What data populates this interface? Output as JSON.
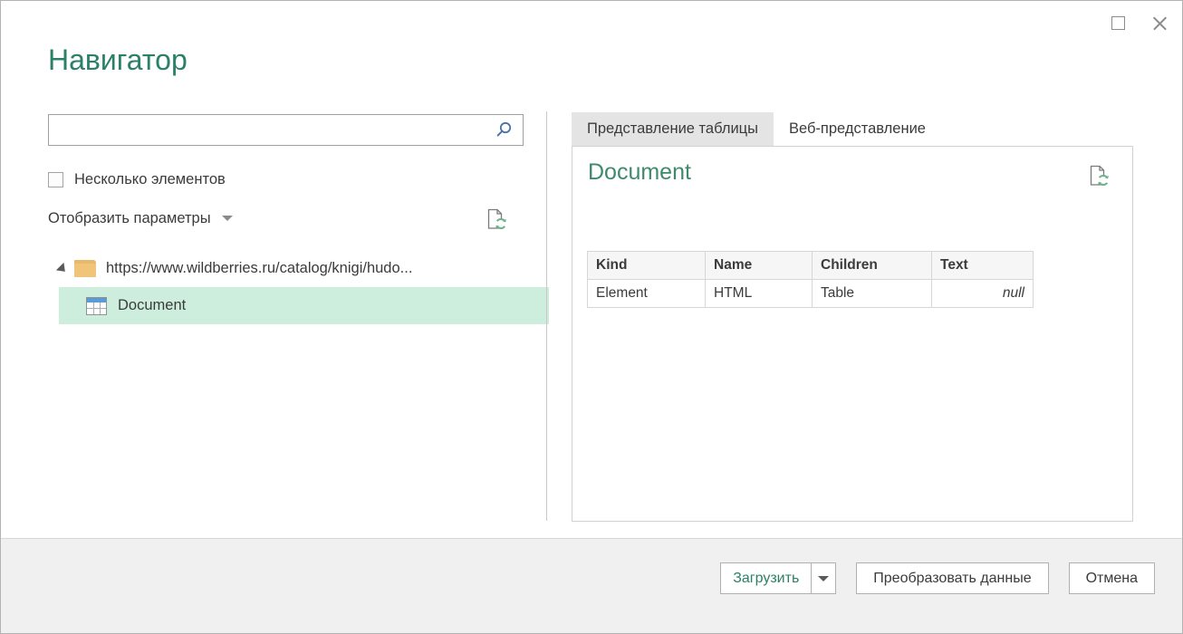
{
  "window": {
    "maximize_icon": "maximize-square-icon",
    "close_icon": "close-x-icon"
  },
  "title": "Навигатор",
  "left_pane": {
    "search": {
      "value": "",
      "placeholder": "",
      "icon": "search-magnifier-icon"
    },
    "multiple_items_checkbox": {
      "label": "Несколько элементов",
      "checked": false
    },
    "display_options": {
      "label": "Отобразить параметры",
      "caret_icon": "chevron-down-icon"
    },
    "refresh_icon": "page-refresh-icon",
    "tree": {
      "root": {
        "label": "https://www.wildberries.ru/catalog/knigi/hudo...",
        "icon": "folder-icon",
        "expander_icon": "expander-expanded-icon",
        "expanded": true
      },
      "children": [
        {
          "label": "Document",
          "icon": "table-icon",
          "selected": true
        }
      ]
    }
  },
  "right_pane": {
    "tabs": [
      {
        "label": "Представление таблицы",
        "active": true
      },
      {
        "label": "Веб-представление",
        "active": false
      }
    ],
    "preview": {
      "title": "Document",
      "refresh_icon": "page-refresh-icon",
      "table": {
        "columns": [
          "Kind",
          "Name",
          "Children",
          "Text"
        ],
        "rows": [
          [
            "Element",
            "HTML",
            "Table",
            "null"
          ]
        ]
      }
    }
  },
  "footer": {
    "load_button": "Загрузить",
    "load_dropdown_icon": "chevron-down-icon",
    "transform_button": "Преобразовать данные",
    "cancel_button": "Отмена"
  },
  "colors": {
    "title_green": "#2b8068",
    "preview_title_green": "#3f8a6d",
    "selection_green": "#cdeedd",
    "folder_orange": "#f0c479",
    "search_icon_blue": "#4a72a8",
    "refresh_green": "#6fb08e",
    "footer_bg": "#f0f0f0",
    "active_tab_bg": "#e4e4e4"
  }
}
